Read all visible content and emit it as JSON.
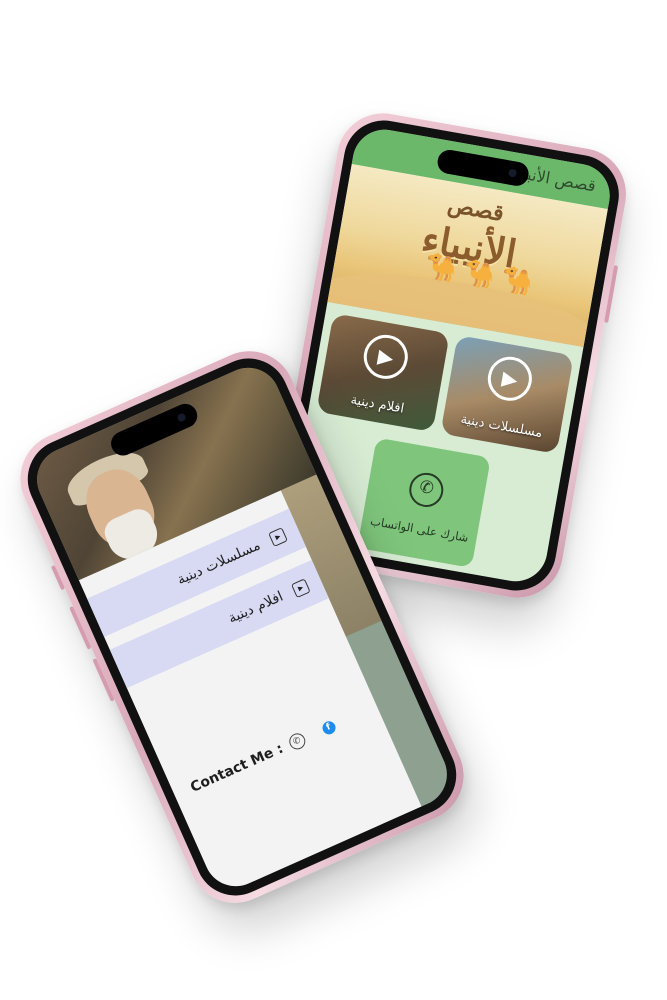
{
  "app_title": "قصص الأنبياء والرسل",
  "banner": {
    "line1": "قصص",
    "line2": "الأنبياء",
    "camels": "🐪🐪🐪"
  },
  "home": {
    "cards": [
      {
        "label": "مسلسلات دينية",
        "icon": "play-icon"
      },
      {
        "label": "افلام دينية",
        "icon": "play-icon"
      }
    ],
    "share_label": "شارك على الواتساب",
    "share_icon": "whatsapp-icon"
  },
  "drawer": {
    "items": [
      {
        "label": "مسلسلات دينية",
        "icon": "video-icon"
      },
      {
        "label": "افلام دينية",
        "icon": "video-icon"
      }
    ],
    "contact_label": "Contact Me :",
    "contact_icons": [
      "whatsapp-icon",
      "facebook-icon"
    ]
  },
  "colors": {
    "appbar": "#6cb86a",
    "home_background": "#d8ecd4",
    "share_button": "#7fc67c",
    "drawer_item": "#d7daf2",
    "drawer_background": "#f3f3f3",
    "facebook": "#1d8cf0",
    "phone_frame": "#e5b8c6"
  }
}
